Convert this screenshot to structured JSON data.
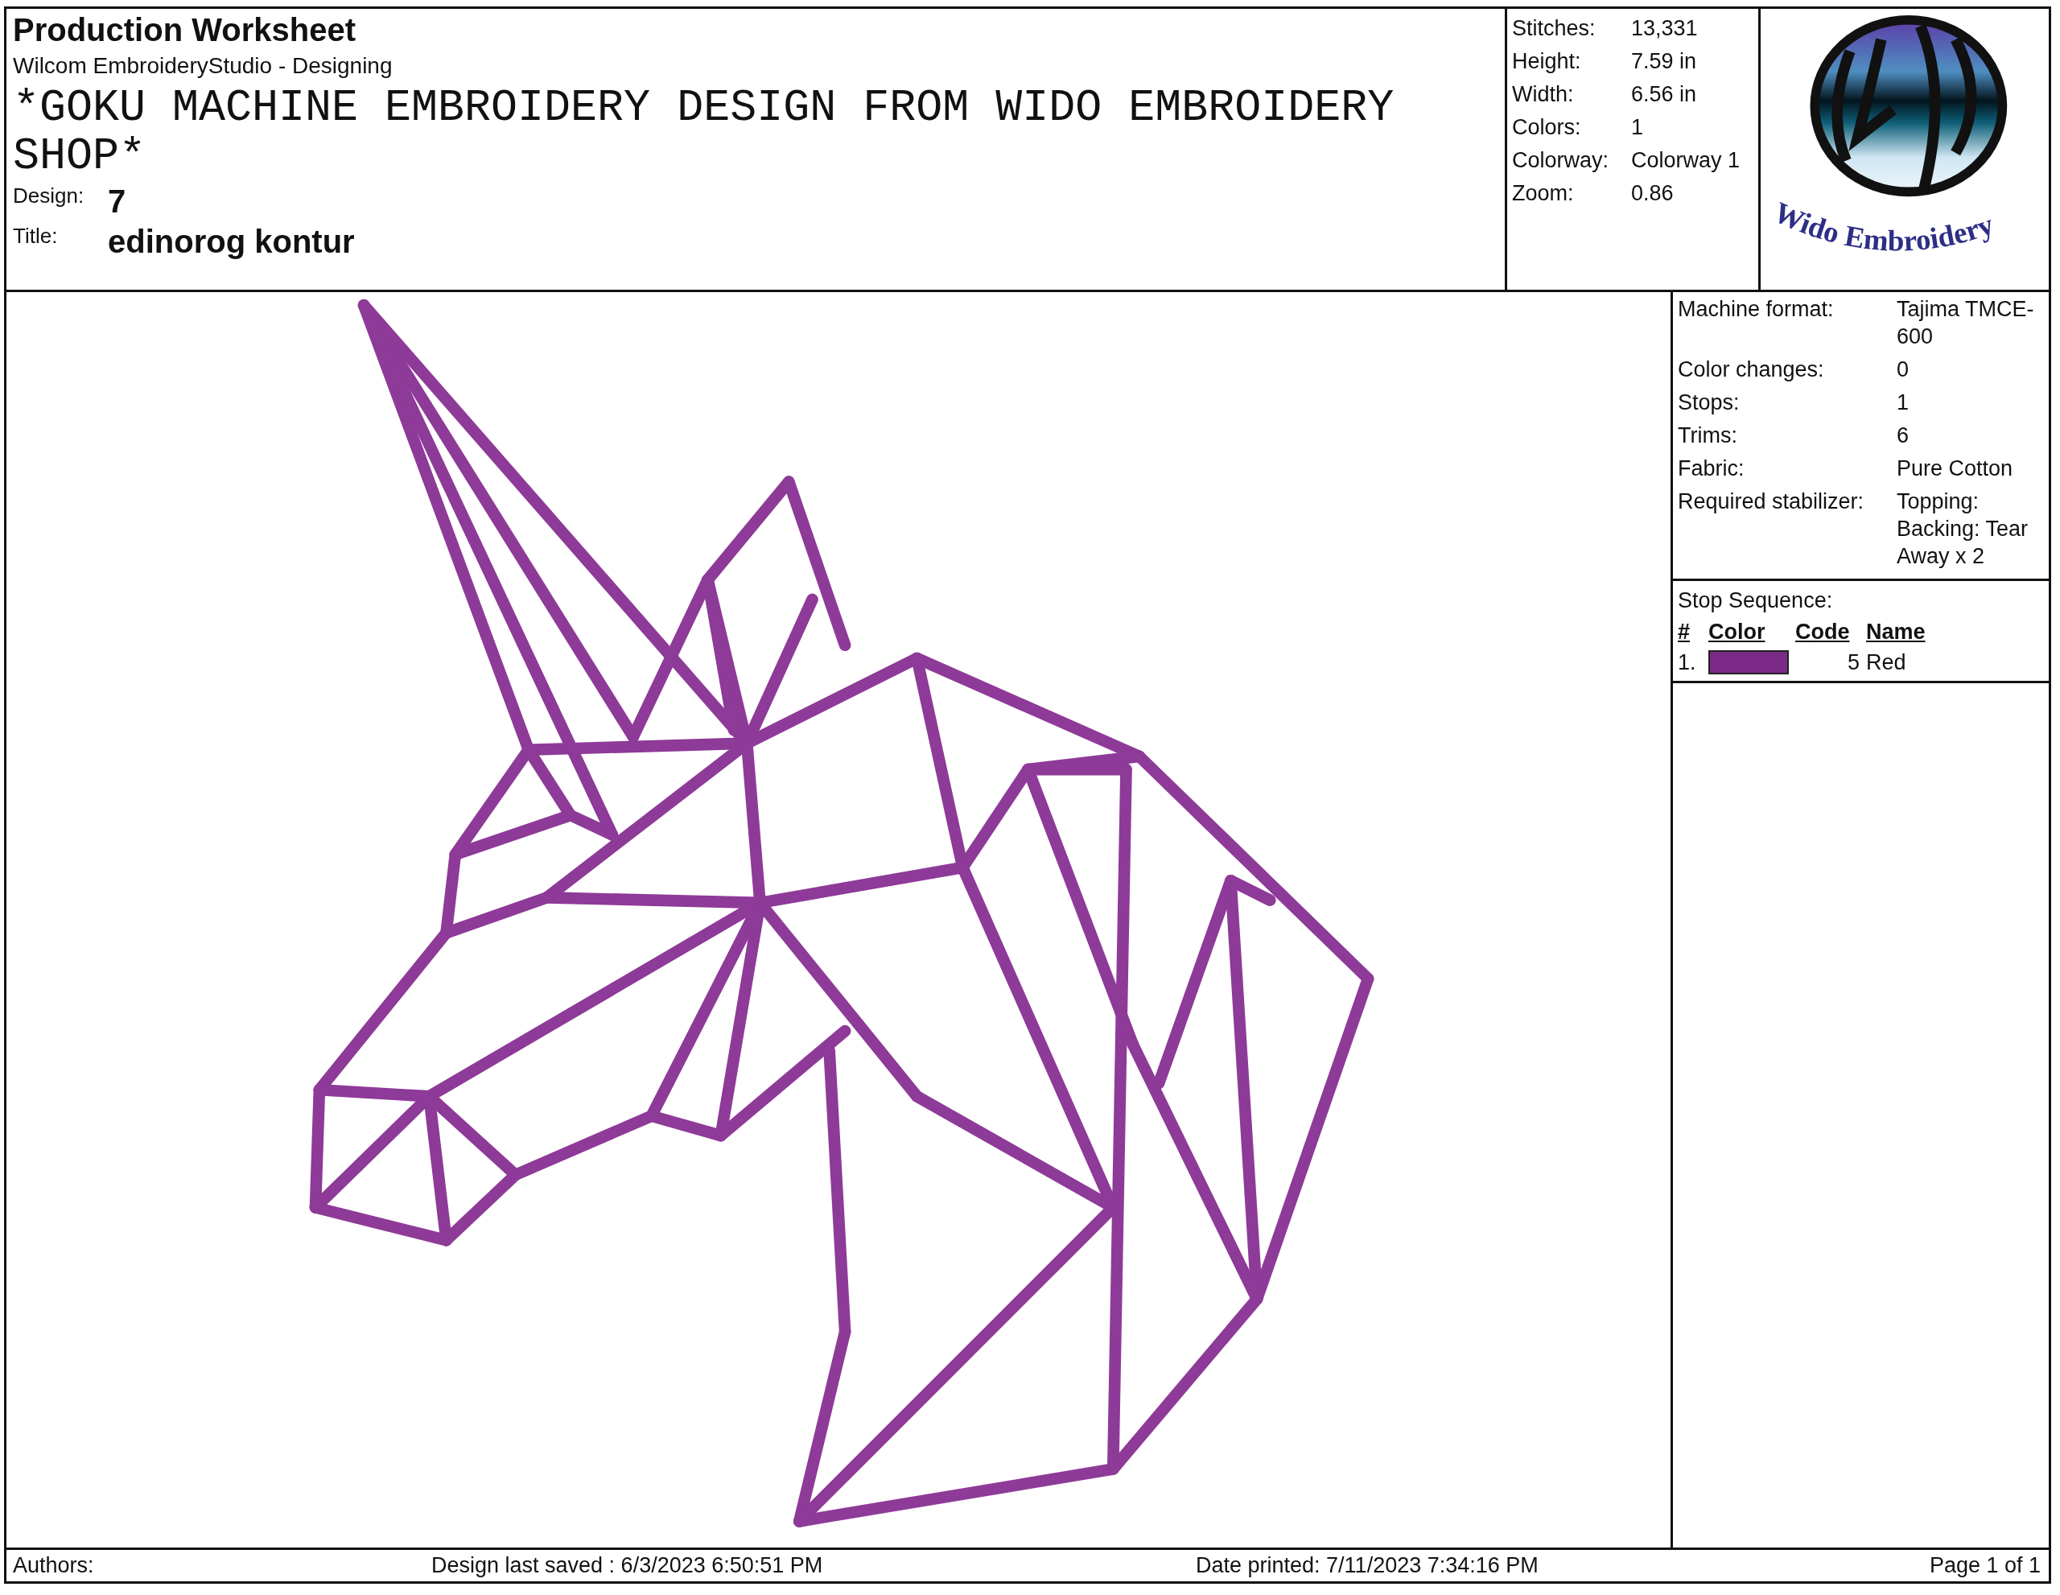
{
  "header": {
    "title": "Production Worksheet",
    "software": "Wilcom EmbroideryStudio - Designing",
    "description": "*GOKU MACHINE EMBROIDERY DESIGN FROM WIDO EMBROIDERY SHOP*",
    "fields": [
      {
        "label": "Design:",
        "value": "7"
      },
      {
        "label": "Title:",
        "value": "edinorog kontur"
      }
    ]
  },
  "stats": [
    {
      "label": "Stitches:",
      "value": "13,331"
    },
    {
      "label": "Height:",
      "value": "7.59 in"
    },
    {
      "label": "Width:",
      "value": "6.56 in"
    },
    {
      "label": "Colors:",
      "value": "1"
    },
    {
      "label": "Colorway:",
      "value": "Colorway 1"
    },
    {
      "label": "Zoom:",
      "value": "0.86"
    }
  ],
  "logo": {
    "text": "Wido Embroidery"
  },
  "machine_info": [
    {
      "label": "Machine format:",
      "value": "Tajima TMCE-600"
    },
    {
      "label": "Color changes:",
      "value": "0"
    },
    {
      "label": "Stops:",
      "value": "1"
    },
    {
      "label": "Trims:",
      "value": "6"
    },
    {
      "label": "Fabric:",
      "value": "Pure Cotton"
    },
    {
      "label": "Required stabilizer:",
      "value": "Topping: Backing: Tear Away x 2"
    }
  ],
  "stop_sequence": {
    "title": "Stop Sequence:",
    "columns": [
      "#",
      "Color",
      "Code",
      "Name"
    ],
    "rows": [
      {
        "number": "1.",
        "color": "#7b2a87",
        "code": "5",
        "name": "Red"
      }
    ]
  },
  "footer": {
    "authors": "Authors:",
    "saved": "Design last saved : 6/3/2023 6:50:51 PM",
    "printed": "Date printed: 7/11/2023 7:34:16 PM",
    "page": "Page 1 of 1"
  }
}
